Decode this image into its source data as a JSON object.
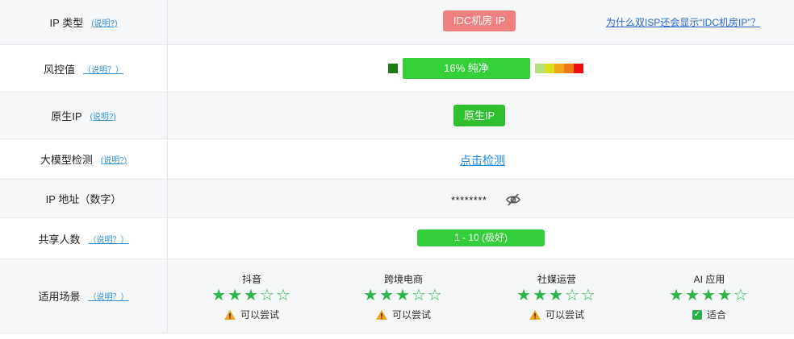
{
  "rows": {
    "ip_type": {
      "label": "IP 类型",
      "help": "(说明?)",
      "tag": "IDC机房 IP",
      "link": "为什么双ISP还会显示“IDC机房IP”？"
    },
    "risk": {
      "label": "风控值",
      "help": "（说明？）",
      "value_text": "16%  纯净",
      "value_percent": 16,
      "scale_colors": [
        "#b5e07a",
        "#dbe01a",
        "#f4a51d",
        "#f07814",
        "#ee0e0e"
      ]
    },
    "native": {
      "label": "原生IP",
      "help": "(说明?)",
      "tag": "原生IP"
    },
    "ai_detect": {
      "label": "大模型检测",
      "help": "(说明?)",
      "link": "点击检测"
    },
    "ip_address": {
      "label": "IP 地址（数字）",
      "masked_value": "********"
    },
    "shared_users": {
      "label": "共享人数",
      "help": "（说明？）",
      "tag": "1 - 10 (极好)"
    },
    "scenarios": {
      "label": "适用场景",
      "help": "（说明？）",
      "items": [
        {
          "name": "抖音",
          "stars": "★★★☆☆",
          "rating": 3,
          "status": "可以尝试",
          "status_icon": "warning-icon"
        },
        {
          "name": "跨境电商",
          "stars": "★★★☆☆",
          "rating": 3,
          "status": "可以尝试",
          "status_icon": "warning-icon"
        },
        {
          "name": "社媒运营",
          "stars": "★★★☆☆",
          "rating": 3,
          "status": "可以尝试",
          "status_icon": "warning-icon"
        },
        {
          "name": "AI 应用",
          "stars": "★★★★☆",
          "rating": 4,
          "status": "适合",
          "status_icon": "check-icon"
        }
      ]
    }
  },
  "colors": {
    "idc_tag": "#f08080",
    "green_tag": "#33d03a",
    "star": "#2db54b",
    "link": "#2766c9"
  }
}
